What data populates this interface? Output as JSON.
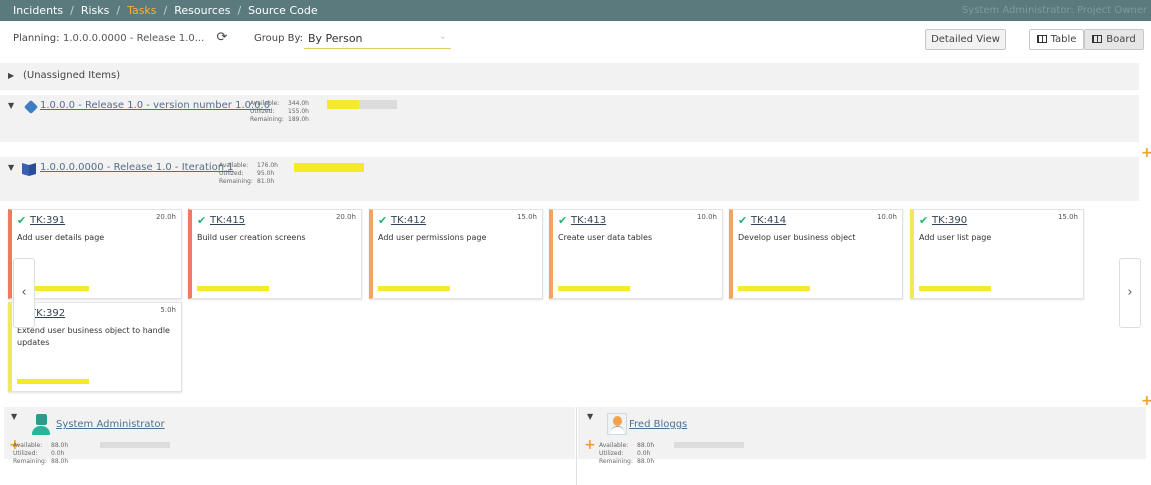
{
  "nav": {
    "items": [
      "Incidents",
      "Risks",
      "Tasks",
      "Resources",
      "Source Code"
    ],
    "role_text": "System Administrator: Project Owner"
  },
  "toolbar": {
    "planning_label": "Planning:",
    "planning_value": "1.0.0.0.0000 - Release 1.0...",
    "groupby_label": "Group By:",
    "groupby_value": "By Person",
    "detailed_view": "Detailed View",
    "table": "Table",
    "board": "Board"
  },
  "unassigned": {
    "title": "(Unassigned Items)"
  },
  "release": {
    "title": "1.0.0.0 - Release 1.0 - version number 1.0.0.0",
    "available_label": "Available:",
    "available": "344.0h",
    "utilized_label": "Utilized:",
    "utilized": "155.0h",
    "remaining_label": "Remaining:",
    "remaining": "189.0h",
    "fill_fraction": 0.45
  },
  "iteration": {
    "title": "1.0.0.0.0000 - Release 1.0 - Iteration 1",
    "available_label": "Available:",
    "available": "176.0h",
    "utilized_label": "Utilized:",
    "utilized": "95.0h",
    "remaining_label": "Remaining:",
    "remaining": "81.0h",
    "fill_fraction": 1.0
  },
  "tasks": [
    {
      "id": "TK:391",
      "hours": "20.0h",
      "name": "Add user details page",
      "priority_color": "#ef7a60"
    },
    {
      "id": "TK:415",
      "hours": "20.0h",
      "name": "Build user creation screens",
      "priority_color": "#ef7a60"
    },
    {
      "id": "TK:412",
      "hours": "15.0h",
      "name": "Add user permissions page",
      "priority_color": "#f5a35a"
    },
    {
      "id": "TK:413",
      "hours": "10.0h",
      "name": "Create user data tables",
      "priority_color": "#f5a35a"
    },
    {
      "id": "TK:414",
      "hours": "10.0h",
      "name": "Develop user business object",
      "priority_color": "#f5a35a"
    },
    {
      "id": "TK:390",
      "hours": "15.0h",
      "name": "Add user list page",
      "priority_color": "#f2e95a"
    },
    {
      "id": "TK:392",
      "hours": "5.0h",
      "name": "Extend user business object to handle updates",
      "priority_color": "#f2e95a"
    }
  ],
  "people": [
    {
      "name": "System Administrator",
      "available_label": "Available:",
      "available": "88.0h",
      "utilized_label": "Utilized:",
      "utilized": "0.0h",
      "remaining_label": "Remaining:",
      "remaining": "88.0h"
    },
    {
      "name": "Fred Bloggs",
      "available_label": "Available:",
      "available": "88.0h",
      "utilized_label": "Utilized:",
      "utilized": "0.0h",
      "remaining_label": "Remaining:",
      "remaining": "88.0h"
    }
  ],
  "icons": {
    "refresh": "refresh-icon",
    "chevron_left": "chevron-left-icon",
    "chevron_right": "chevron-right-icon",
    "add": "plus-icon",
    "expand": "triangle-icon"
  },
  "colors": {
    "nav_bg": "#5a7a7e",
    "nav_active": "#f3b23c",
    "progress": "#f5ea2a",
    "check": "#22b573",
    "add": "#f0a030"
  }
}
